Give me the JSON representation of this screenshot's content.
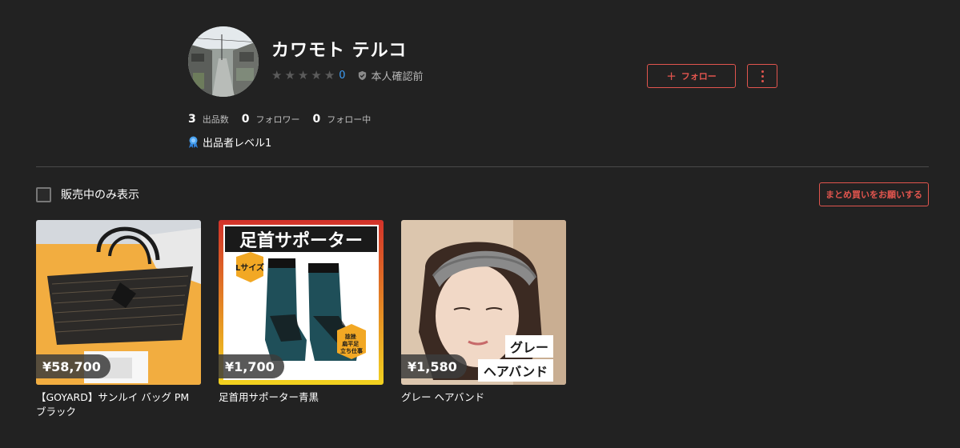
{
  "profile": {
    "name": "カワモト テルコ",
    "rating_count": "0",
    "verification": "本人確認前",
    "follow_label": "フォロー",
    "level": "出品者レベル1",
    "stats": [
      {
        "num": "3",
        "label": "出品数"
      },
      {
        "num": "0",
        "label": "フォロワー"
      },
      {
        "num": "0",
        "label": "フォロー中"
      }
    ]
  },
  "filter": {
    "label": "販売中のみ表示",
    "checked": false
  },
  "bulk_button": "まとめ買いをお願いする",
  "products": [
    {
      "price": "¥58,700",
      "title": "【GOYARD】サンルイ バッグ PM ブラック"
    },
    {
      "price": "¥1,700",
      "title": "足首用サポーター青黒",
      "image_text": {
        "heading": "足首サポーター",
        "badge": "Lサイズ",
        "note": "捻挫\n扁平足\n立ち仕事"
      }
    },
    {
      "price": "¥1,580",
      "title": "グレー ヘアバンド",
      "image_text": {
        "line1": "グレー",
        "line2": "ヘアバンド"
      }
    }
  ],
  "colors": {
    "accent": "#e1554e",
    "background": "#222222",
    "link": "#3d9df5"
  }
}
